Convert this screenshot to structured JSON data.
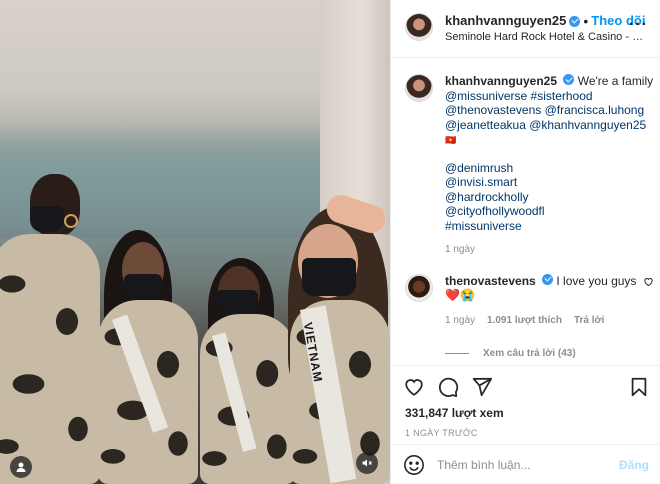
{
  "header": {
    "username": "khanhvannguyen25",
    "separator": "•",
    "follow_label": "Theo dõi",
    "location": "Seminole Hard Rock Hotel & Casino - Hollywood",
    "more_icon": "more-horizontal-icon"
  },
  "caption": {
    "username": "khanhvannguyen25",
    "text": "We're a family",
    "tags_line1": "@missuniverse #sisterhood",
    "tags_line2": "@thenovastevens @francisca.luhong",
    "tags_line3": "@jeanetteakua @khanhvannguyen25",
    "flag": "🇻🇳",
    "tags_more": [
      "@denimrush",
      "@invisi.smart",
      "@hardrockholly",
      "@cityofhollywoodfl",
      "#missuniverse"
    ],
    "time": "1 ngày"
  },
  "comment": {
    "username": "thenovastevens",
    "text": "I love you guys",
    "emojis": "❤️😭",
    "time": "1 ngày",
    "likes": "1.091 lượt thích",
    "reply_label": "Trả lời",
    "view_replies": "Xem câu trả lời (43)"
  },
  "actions": {
    "like_icon": "heart-icon",
    "comment_icon": "comment-icon",
    "share_icon": "share-icon",
    "save_icon": "bookmark-icon"
  },
  "views": "331,847 lượt xem",
  "date": "1 NGÀY TRƯỚC",
  "composer": {
    "emoji_icon": "emoji-icon",
    "placeholder": "Thêm bình luận...",
    "post_label": "Đăng"
  },
  "media": {
    "sash_text": "VIETNAM",
    "user_icon": "user-tag-icon",
    "mute_icon": "mute-icon"
  },
  "colors": {
    "accent": "#0095f6",
    "link": "#00376b",
    "muted": "#8e8e8e",
    "verified": "#3897f0",
    "heart": "#ed4956",
    "post_disabled": "#b2dffc"
  }
}
